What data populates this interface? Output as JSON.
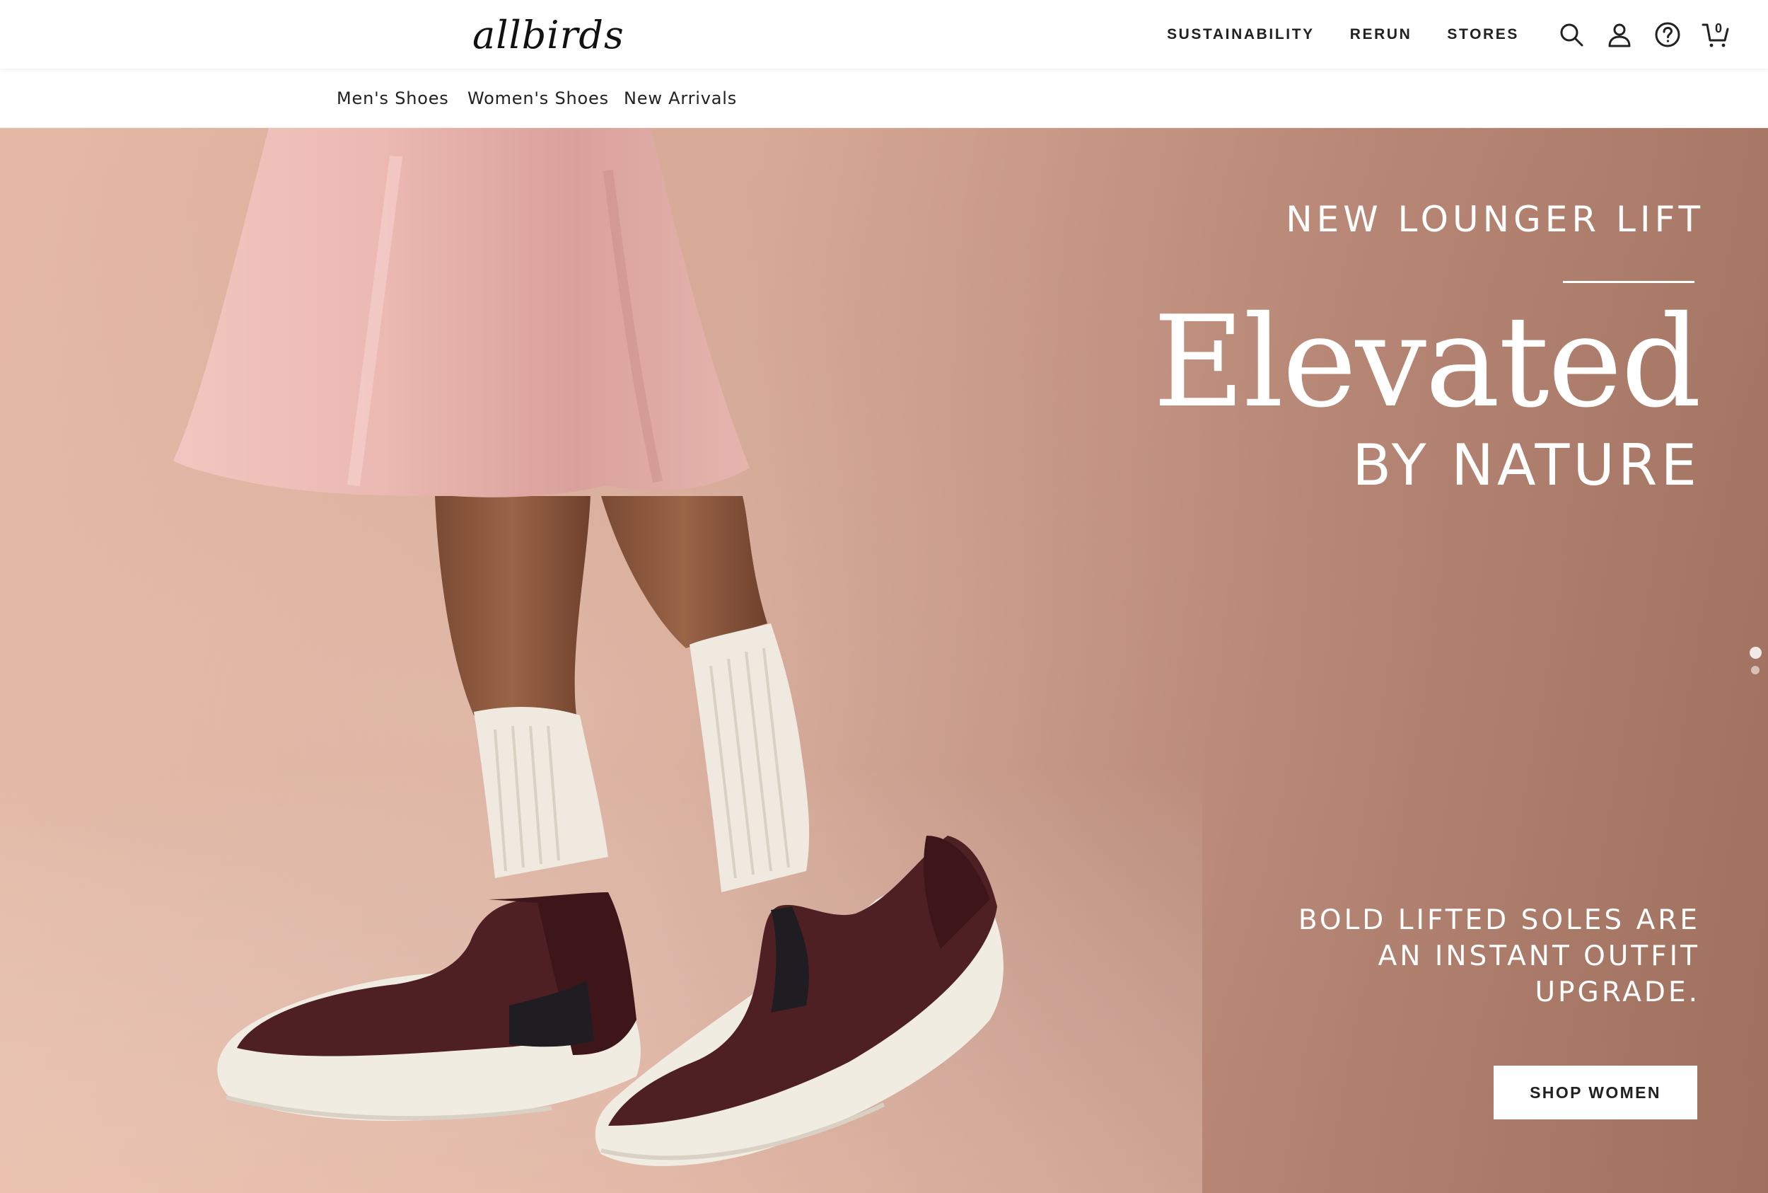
{
  "header": {
    "logo": "allbirds",
    "nav": [
      "SUSTAINABILITY",
      "RERUN",
      "STORES"
    ],
    "icons": [
      "search-icon",
      "account-icon",
      "help-icon",
      "cart-icon"
    ],
    "cart_count": "0"
  },
  "subnav": {
    "items": [
      "Men's Shoes",
      "Women's Shoes",
      "New Arrivals"
    ]
  },
  "hero": {
    "eyebrow": "NEW LOUNGER LIFT",
    "title": "Elevated",
    "subtitle": "BY NATURE",
    "body": "BOLD LIFTED SOLES ARE AN INSTANT OUTFIT UPGRADE.",
    "cta": "SHOP WOMEN",
    "slide_count": 2,
    "active_slide": 1
  },
  "colors": {
    "background_left": "#e8bca8",
    "background_right": "#a0705f",
    "skirt": "#e9b3ad",
    "shoe_upper": "#4e1f23",
    "sole": "#f1ece2",
    "sock": "#efe9df"
  }
}
